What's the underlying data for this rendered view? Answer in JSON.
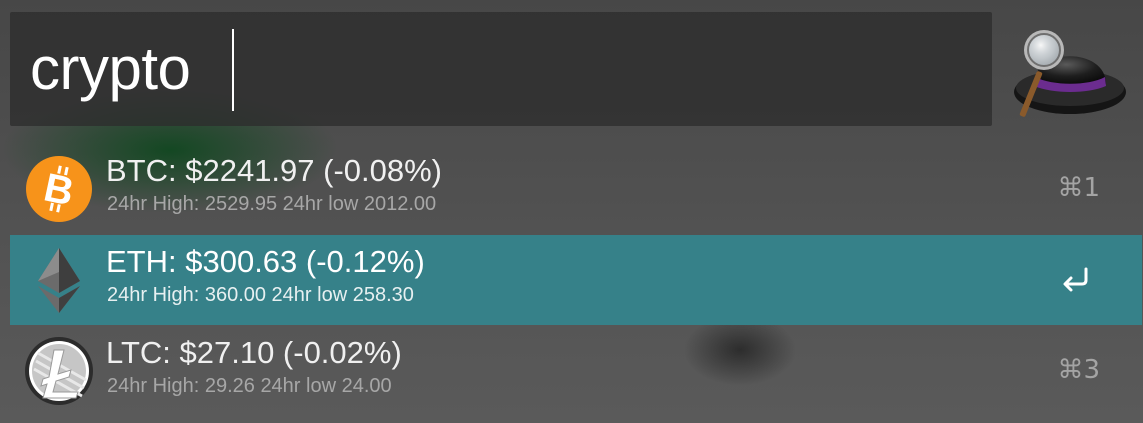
{
  "search": {
    "query": "crypto"
  },
  "results": [
    {
      "icon": "bitcoin-icon",
      "title": "BTC: $2241.97 (-0.08%)",
      "subtitle": "24hr High: 2529.95 24hr low 2012.00",
      "shortcut": "⌘1",
      "selected": false
    },
    {
      "icon": "ethereum-icon",
      "title": "ETH: $300.63 (-0.12%)",
      "subtitle": "24hr High: 360.00 24hr low 258.30",
      "shortcut": "return-icon",
      "selected": true
    },
    {
      "icon": "litecoin-icon",
      "title": "LTC: $27.10 (-0.02%)",
      "subtitle": "24hr High: 29.26 24hr low 24.00",
      "shortcut": "⌘3",
      "selected": false
    }
  ],
  "colors": {
    "selection": "#368189",
    "bitcoin": "#F7931A",
    "hat_band": "#6B2C8F"
  },
  "logo": "alfred-hat-logo-icon"
}
